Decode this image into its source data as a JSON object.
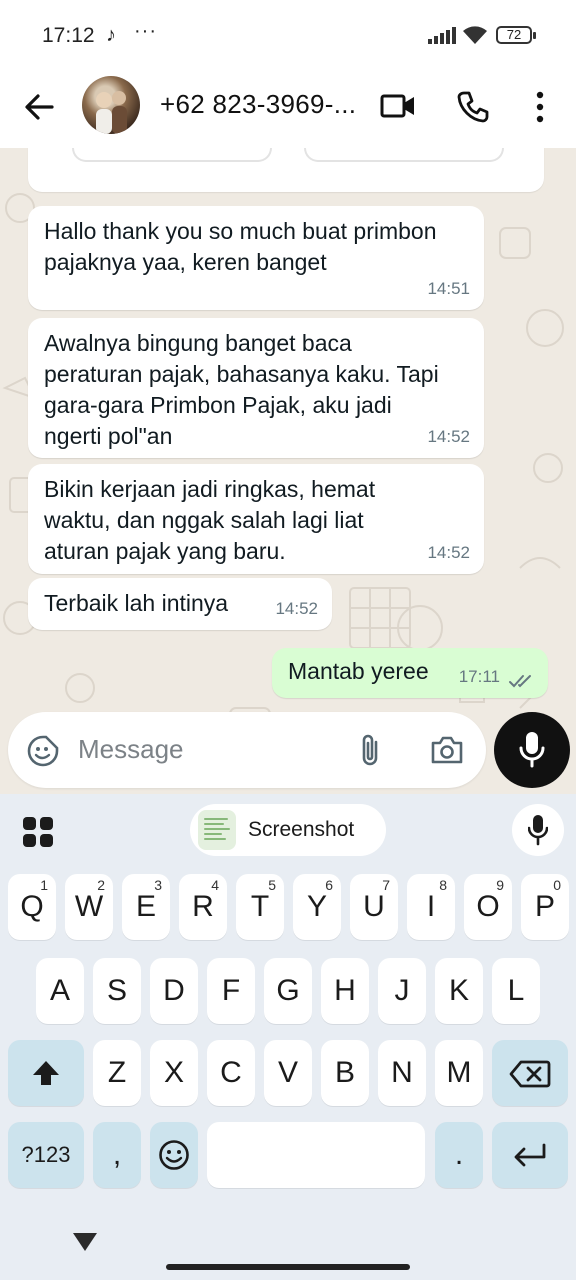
{
  "status_bar": {
    "time": "17:12",
    "extra": "···",
    "battery": "72"
  },
  "header": {
    "contact_name": "+62 823-3969-..."
  },
  "messages": [
    {
      "text": "Hallo thank you so much buat primbon pajaknya yaa, keren banget",
      "time": "14:51",
      "direction": "in"
    },
    {
      "text": "Awalnya bingung banget baca peraturan pajak, bahasanya kaku. Tapi gara-gara Primbon Pajak, aku jadi ngerti pol\"an",
      "time": "14:52",
      "direction": "in"
    },
    {
      "text": "Bikin kerjaan jadi ringkas, hemat waktu, dan nggak salah lagi liat aturan pajak yang baru.",
      "time": "14:52",
      "direction": "in"
    },
    {
      "text": "Terbaik lah intinya",
      "time": "14:52",
      "direction": "in"
    },
    {
      "text": "Mantab yeree",
      "time": "17:11",
      "direction": "out",
      "status": "read"
    }
  ],
  "composer": {
    "placeholder": "Message"
  },
  "keyboard": {
    "clipboard_chip": "Screenshot",
    "row1": [
      "Q",
      "W",
      "E",
      "R",
      "T",
      "Y",
      "U",
      "I",
      "O",
      "P"
    ],
    "row1_hints": [
      "1",
      "2",
      "3",
      "4",
      "5",
      "6",
      "7",
      "8",
      "9",
      "0"
    ],
    "row2": [
      "A",
      "S",
      "D",
      "F",
      "G",
      "H",
      "J",
      "K",
      "L"
    ],
    "row3": [
      "Z",
      "X",
      "C",
      "V",
      "B",
      "N",
      "M"
    ],
    "symbols_key": "?123",
    "comma_key": ",",
    "period_key": "."
  },
  "colors": {
    "chat_bg": "#efeae2",
    "outgoing_bubble": "#d9fdd3",
    "keyboard_bg": "#e8edf3",
    "function_key": "#cce3ed",
    "read_ticks": "#53bdeb"
  },
  "icons": [
    "back-arrow-icon",
    "video-call-icon",
    "phone-icon",
    "more-vert-icon",
    "emoji-icon",
    "attach-icon",
    "camera-icon",
    "mic-icon",
    "apps-grid-icon",
    "shift-icon",
    "backspace-icon",
    "enter-icon",
    "nav-back-icon"
  ]
}
